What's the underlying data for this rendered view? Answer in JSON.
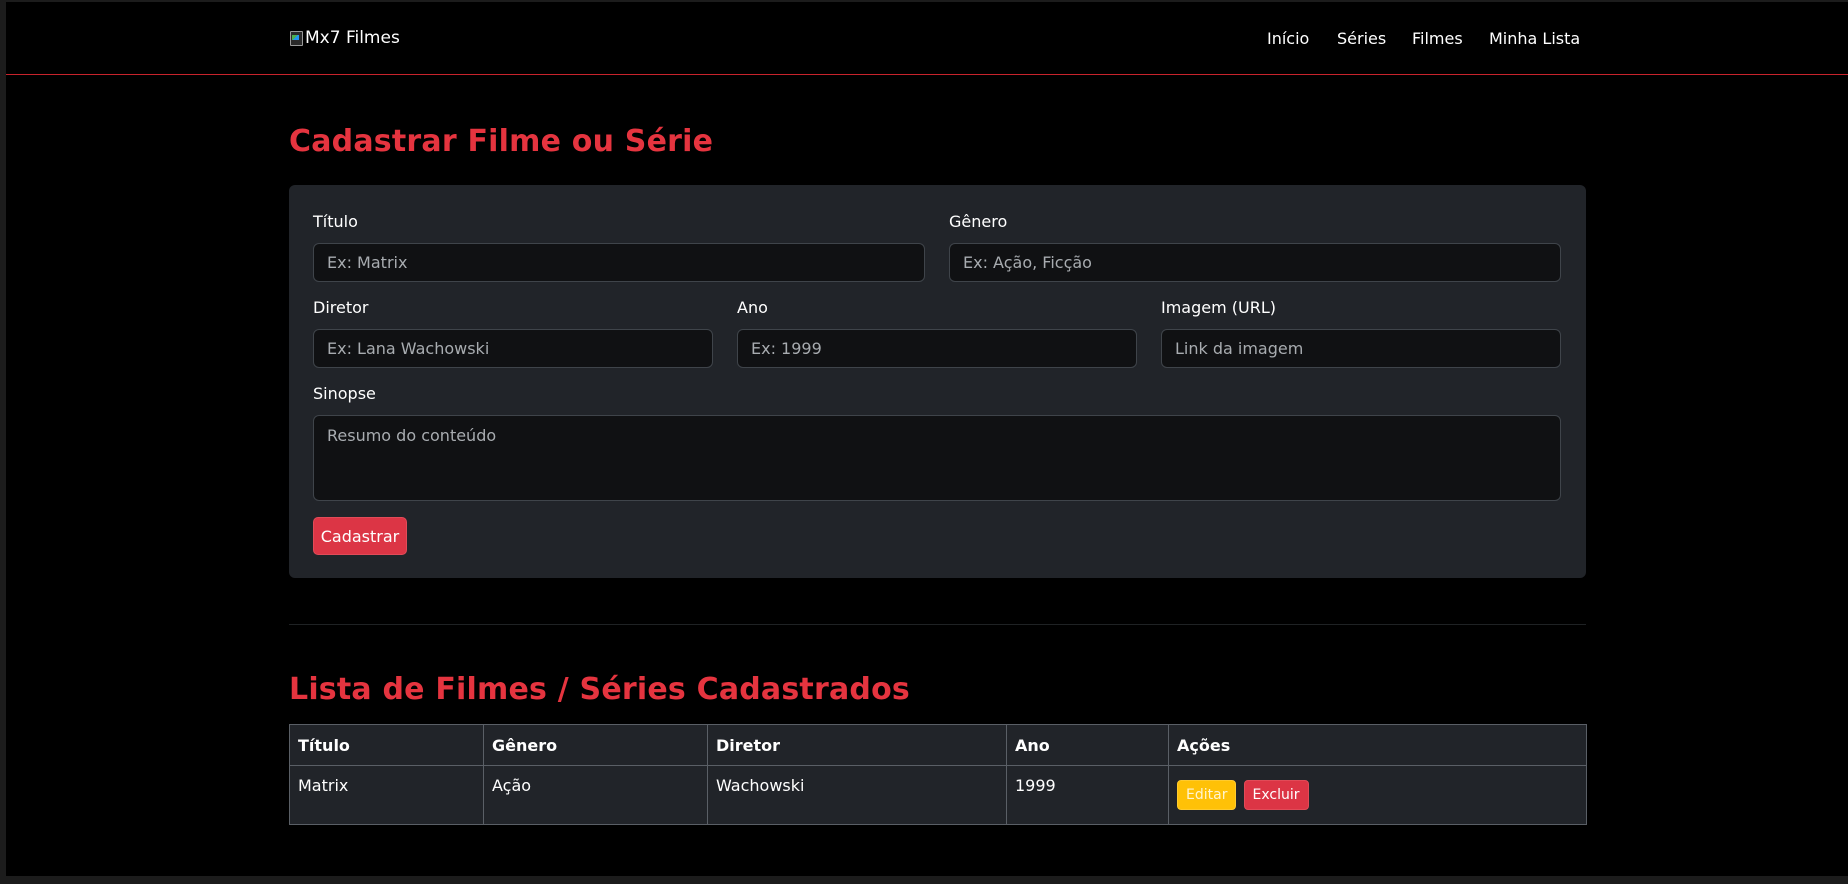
{
  "navbar": {
    "brand_alt": "Mx7 Filmes",
    "links": [
      "Início",
      "Séries",
      "Filmes",
      "Minha Lista"
    ]
  },
  "form": {
    "title": "Cadastrar Filme ou Série",
    "fields": {
      "titulo": {
        "label": "Título",
        "placeholder": "Ex: Matrix",
        "value": ""
      },
      "genero": {
        "label": "Gênero",
        "placeholder": "Ex: Ação, Ficção",
        "value": ""
      },
      "diretor": {
        "label": "Diretor",
        "placeholder": "Ex: Lana Wachowski",
        "value": ""
      },
      "ano": {
        "label": "Ano",
        "placeholder": "Ex: 1999",
        "value": ""
      },
      "imagem": {
        "label": "Imagem (URL)",
        "placeholder": "Link da imagem",
        "value": ""
      },
      "sinopse": {
        "label": "Sinopse",
        "placeholder": "Resumo do conteúdo",
        "value": ""
      }
    },
    "submit_label": "Cadastrar"
  },
  "list": {
    "title": "Lista de Filmes / Séries Cadastrados",
    "columns": [
      "Título",
      "Gênero",
      "Diretor",
      "Ano",
      "Ações"
    ],
    "rows": [
      {
        "titulo": "Matrix",
        "genero": "Ação",
        "diretor": "Wachowski",
        "ano": "1999"
      }
    ],
    "edit_label": "Editar",
    "delete_label": "Excluir"
  },
  "colors": {
    "accent": "#dc3545",
    "title_red": "#e5343f",
    "warning": "#ffc107",
    "card_bg": "#212429",
    "page_bg": "#000000"
  }
}
